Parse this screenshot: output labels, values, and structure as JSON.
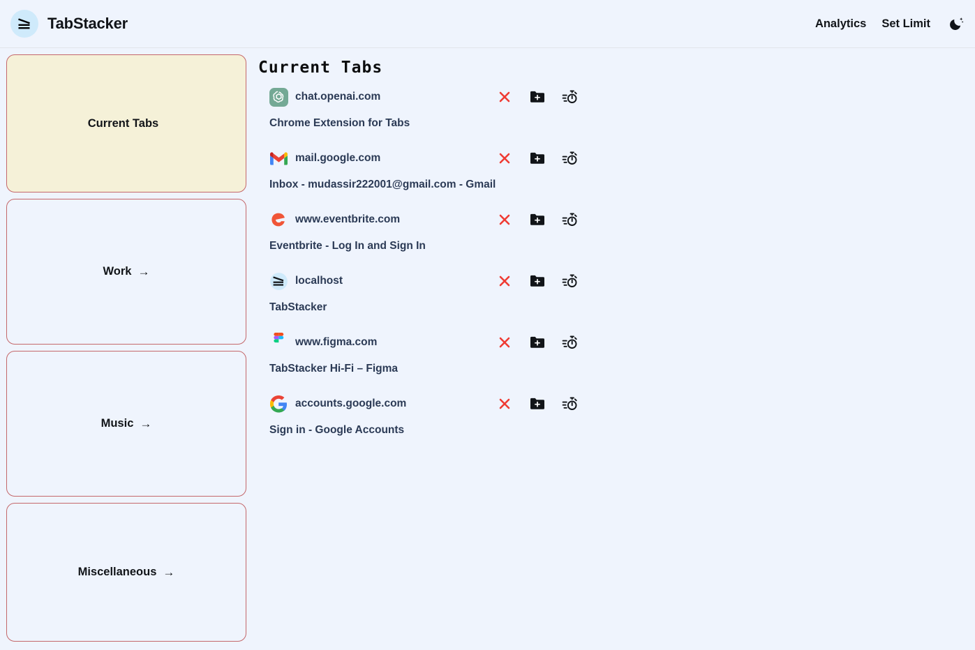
{
  "header": {
    "logo_icon": "tabstacker-logo-icon",
    "brand_name": "TabStacker",
    "nav": [
      {
        "label": "Analytics",
        "name": "analytics"
      },
      {
        "label": "Set Limit",
        "name": "set-limit"
      }
    ],
    "theme_toggle_icon": "moon-icon"
  },
  "sidebar": {
    "groups": [
      {
        "label": "Current Tabs",
        "active": true,
        "arrow": "",
        "size": "a"
      },
      {
        "label": "Work",
        "active": false,
        "arrow": "→",
        "size": "b"
      },
      {
        "label": "Music",
        "active": false,
        "arrow": "→",
        "size": "c"
      },
      {
        "label": "Miscellaneous",
        "active": false,
        "arrow": "→",
        "size": "d"
      }
    ]
  },
  "main": {
    "title": "Current Tabs",
    "actions": {
      "close_label": "×",
      "close_icon": "close-icon",
      "folder_icon": "add-to-folder-icon",
      "timer_icon": "stopwatch-icon"
    },
    "tabs": [
      {
        "favicon": "openai-icon",
        "domain": "chat.openai.com",
        "title": "Chrome Extension for Tabs"
      },
      {
        "favicon": "gmail-icon",
        "domain": "mail.google.com",
        "title": "Inbox - mudassir222001@gmail.com - Gmail"
      },
      {
        "favicon": "eventbrite-icon",
        "domain": "www.eventbrite.com",
        "title": "Eventbrite - Log In and Sign In"
      },
      {
        "favicon": "tabstacker-icon",
        "domain": "localhost",
        "title": "TabStacker"
      },
      {
        "favicon": "figma-icon",
        "domain": "www.figma.com",
        "title": "TabStacker Hi-Fi – Figma"
      },
      {
        "favicon": "google-icon",
        "domain": "accounts.google.com",
        "title": "Sign in - Google Accounts"
      }
    ]
  },
  "colors": {
    "page_background": "#eff4fd",
    "card_border": "#c4676a",
    "card_active_background": "#f5f1d8",
    "logo_background": "#cfeafb",
    "text_primary": "#111418",
    "text_tab": "#2b3a55",
    "close_red": "#ef3b33"
  }
}
